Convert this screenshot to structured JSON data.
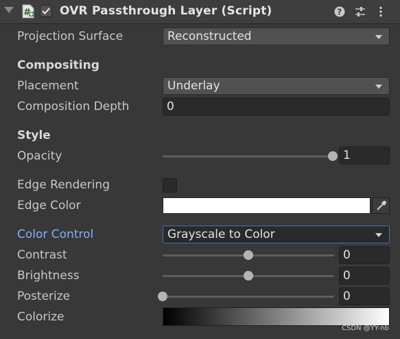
{
  "header": {
    "title": "OVR Passthrough Layer (Script)",
    "enabled": true,
    "icons": [
      "fold-triangle-icon",
      "script-icon",
      "help-icon",
      "presets-icon",
      "more-icon"
    ]
  },
  "fields": {
    "projection_surface": {
      "label": "Projection Surface",
      "value": "Reconstructed"
    },
    "compositing_heading": "Compositing",
    "placement": {
      "label": "Placement",
      "value": "Underlay"
    },
    "composition_depth": {
      "label": "Composition Depth",
      "value": "0"
    },
    "style_heading": "Style",
    "opacity": {
      "label": "Opacity",
      "value": "1",
      "fraction": 1.0
    },
    "edge_rendering": {
      "label": "Edge Rendering",
      "checked": false
    },
    "edge_color": {
      "label": "Edge Color",
      "color": "#ffffff"
    },
    "color_control": {
      "label": "Color Control",
      "value": "Grayscale to Color"
    },
    "contrast": {
      "label": "Contrast",
      "value": "0",
      "fraction": 0.5
    },
    "brightness": {
      "label": "Brightness",
      "value": "0",
      "fraction": 0.5
    },
    "posterize": {
      "label": "Posterize",
      "value": "0",
      "fraction": 0.0
    },
    "colorize": {
      "label": "Colorize",
      "gradient_from": "#000000",
      "gradient_to": "#ffffff"
    }
  },
  "watermark": "CSDN @YY-nb",
  "colors": {
    "background": "#383838",
    "label_accent": "#7ab4ff",
    "focus_border": "#3a79bb"
  }
}
